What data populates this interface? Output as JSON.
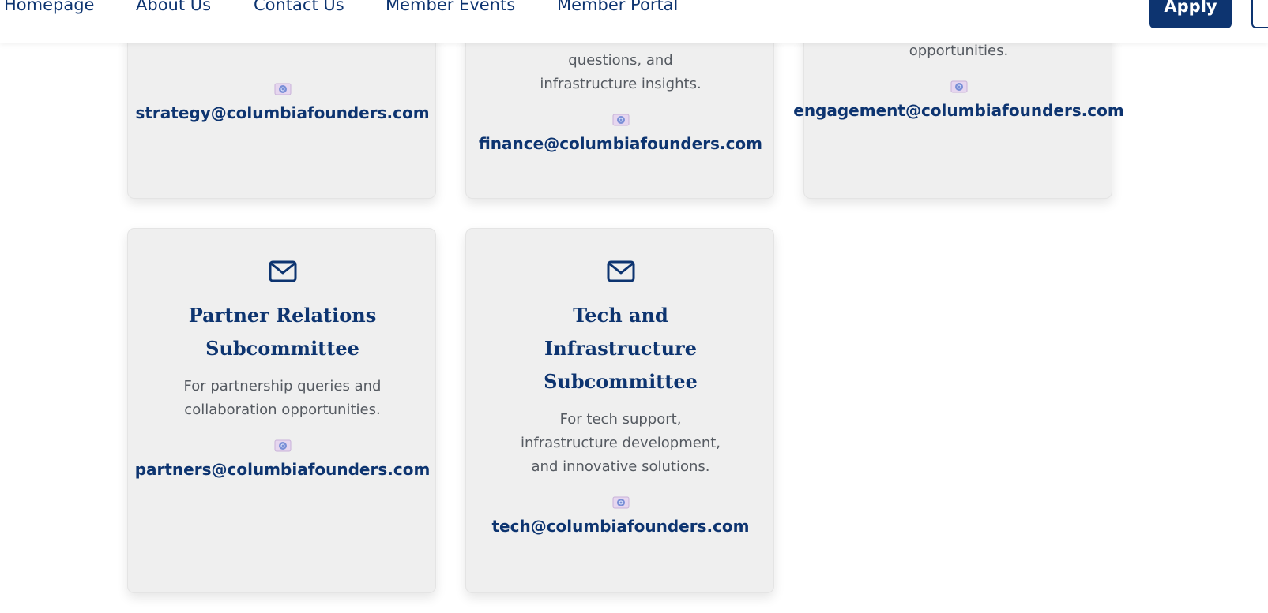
{
  "nav": {
    "links": [
      "Homepage",
      "About Us",
      "Contact Us",
      "Member Events",
      "Member Portal"
    ],
    "apply_label": "Apply"
  },
  "top_cards": [
    {
      "description_tail": "",
      "email": "strategy@columbiafounders.com"
    },
    {
      "description_tail": "questions, and infrastructure insights.",
      "email": "finance@columbiafounders.com"
    },
    {
      "description_tail": "opportunities.",
      "email": "engagement@columbiafounders.com"
    }
  ],
  "cards": [
    {
      "icon": "mail-icon",
      "title": "Partner Relations Subcommittee",
      "description": "For partnership queries and collaboration opportunities.",
      "email_icon": "email-emoji-icon",
      "email": "partners@columbiafounders.com"
    },
    {
      "icon": "mail-icon",
      "title": "Tech and Infrastructure Subcommittee",
      "description": "For tech support, infrastructure development, and innovative solutions.",
      "email_icon": "email-emoji-icon",
      "email": "tech@columbiafounders.com"
    }
  ],
  "colors": {
    "brand_navy": "#0d3470",
    "card_bg": "#efefef",
    "body_text": "#555a61"
  }
}
